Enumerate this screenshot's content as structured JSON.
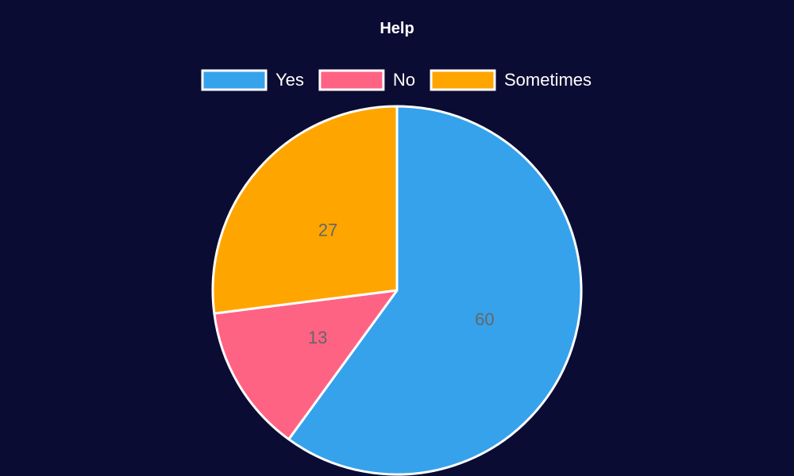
{
  "chart_data": {
    "type": "pie",
    "title": "Help",
    "categories": [
      "Yes",
      "No",
      "Sometimes"
    ],
    "values": [
      60,
      13,
      27
    ],
    "colors": [
      "#36a2eb",
      "#ff6384",
      "#ffa500"
    ],
    "legend_position": "top",
    "data_labels_shown": true,
    "start_angle": "top, clockwise"
  },
  "colors": {
    "background": "#0b0c33",
    "text": "#ffffff",
    "slice_border": "#ffffff",
    "data_label": "#666666"
  }
}
